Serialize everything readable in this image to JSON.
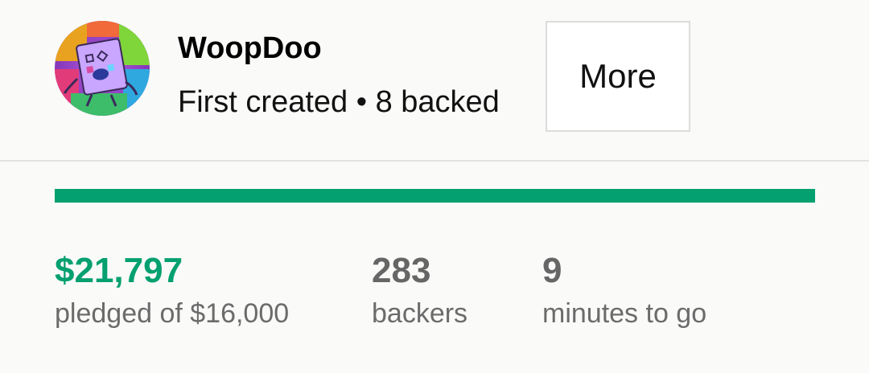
{
  "creator": {
    "name": "WoopDoo",
    "meta": "First created • 8 backed",
    "more_label": "More",
    "avatar_icon": "creator-avatar-icon"
  },
  "campaign": {
    "progress_fraction": 1.0,
    "accent_color": "#05a06f",
    "pledged_value": "$21,797",
    "pledged_label": "pledged of $16,000",
    "backers_value": "283",
    "backers_label": "backers",
    "time_value": "9",
    "time_label": "minutes to go"
  }
}
